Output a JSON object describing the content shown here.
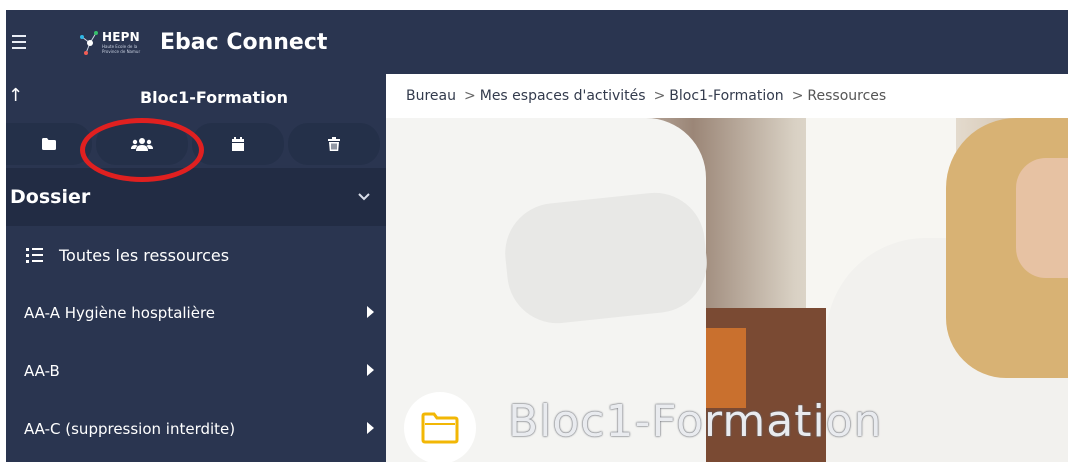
{
  "app": {
    "title": "Ebac Connect",
    "logo_text": "HEPN",
    "logo_subtext": "Haute Ecole de la Province de Namur"
  },
  "sidebar": {
    "title": "Bloc1-Formation",
    "tools": [
      {
        "icon": "folder-icon"
      },
      {
        "icon": "users-icon"
      },
      {
        "icon": "calendar-icon"
      },
      {
        "icon": "trash-icon"
      }
    ],
    "section_label": "Dossier",
    "all_resources_label": "Toutes les ressources",
    "items": [
      {
        "label": "AA-A Hygiène hosptalière"
      },
      {
        "label": "AA-B"
      },
      {
        "label": "AA-C (suppression interdite)"
      }
    ]
  },
  "breadcrumb": {
    "items": [
      "Bureau",
      "Mes espaces d'activités",
      "Bloc1-Formation",
      "Ressources"
    ],
    "separator": ">"
  },
  "hero": {
    "title": "Bloc1-Formation"
  },
  "colors": {
    "navy": "#2a3550",
    "highlight_circle": "#e02020",
    "folder_icon": "#f2b705"
  }
}
